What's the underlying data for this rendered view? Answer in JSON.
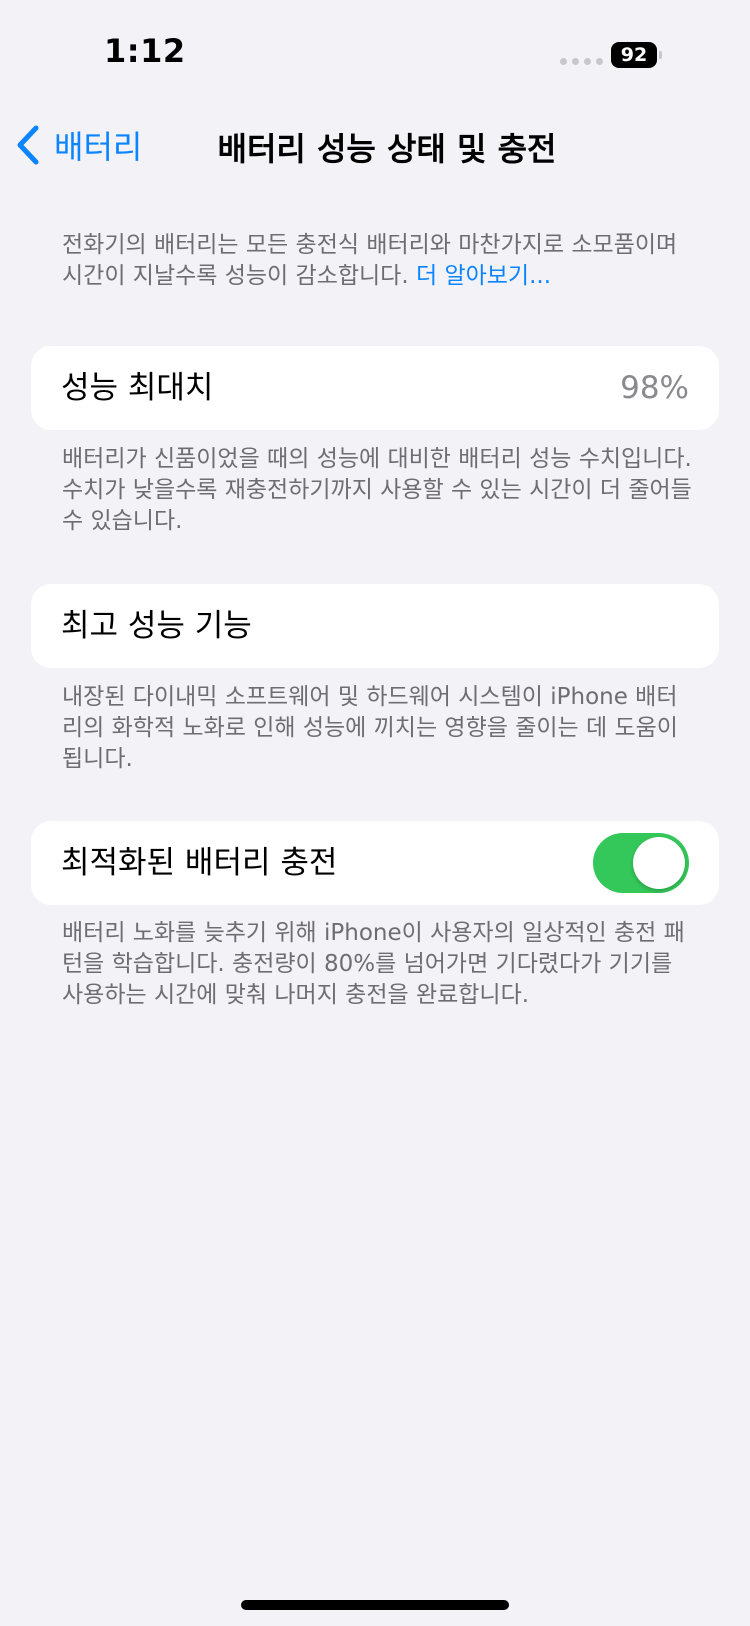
{
  "status_bar": {
    "time": "1:12",
    "battery_level": "92"
  },
  "nav": {
    "back_label": "배터리",
    "title": "배터리 성능 상태 및 충전"
  },
  "intro": {
    "text": "전화기의 배터리는 모든 충전식 배터리와 마찬가지로 소모품이며 시간이 지날수록 성능이 감소합니다.",
    "link": "더 알아보기..."
  },
  "maximum_capacity": {
    "label": "성능 최대치",
    "value": "98%",
    "footnote": "배터리가 신품이었을 때의 성능에 대비한 배터리 성능 수치입니다. 수치가 낮을수록 재충전하기까지 사용할 수 있는 시간이 더 줄어들 수 있습니다."
  },
  "peak_performance": {
    "label": "최고 성능 기능",
    "footnote": "내장된 다이내믹 소프트웨어 및 하드웨어 시스템이 iPhone 배터리의 화학적 노화로 인해 성능에 끼치는 영향을 줄이는 데 도움이 됩니다."
  },
  "optimized_charging": {
    "label": "최적화된 배터리 충전",
    "enabled": true,
    "footnote": "배터리 노화를 늦추기 위해 iPhone이 사용자의 일상적인 충전 패턴을 학습합니다. 충전량이 80%를 넘어가면 기다렸다가 기기를 사용하는 시간에 맞춰 나머지 충전을 완료합니다."
  },
  "colors": {
    "accent": "#0a84ff",
    "toggle_on": "#34c759",
    "background": "#f2f2f7"
  },
  "icons": {
    "back": "chevron-left-icon"
  }
}
